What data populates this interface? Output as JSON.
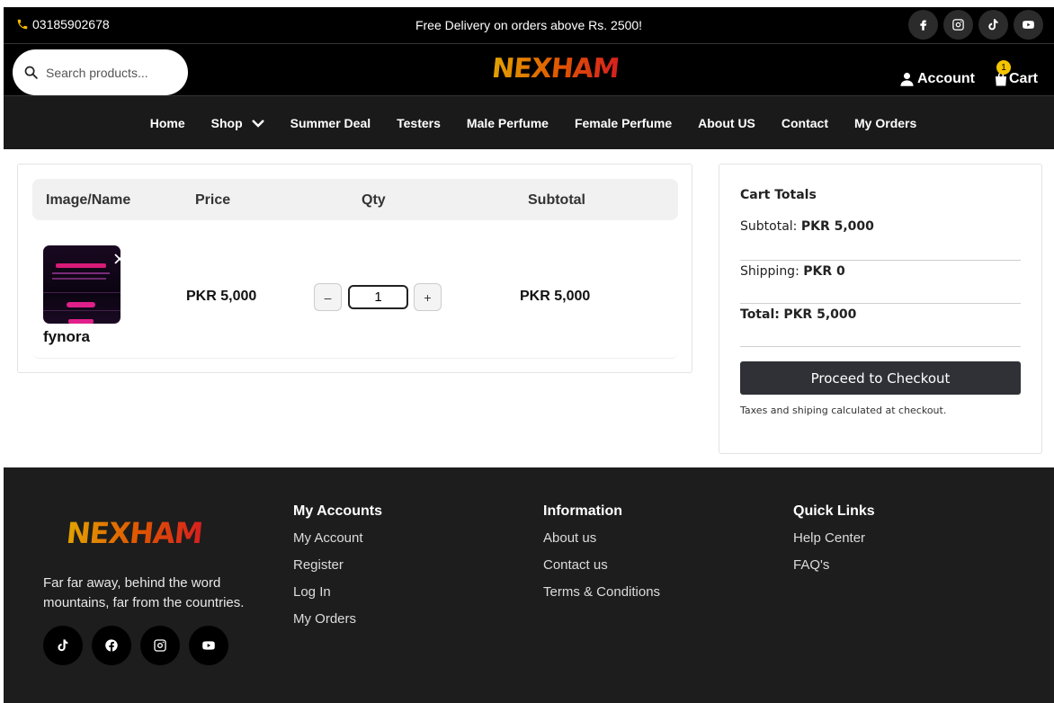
{
  "topbar": {
    "phone": "03185902678",
    "promo": "Free Delivery on orders above Rs. 2500!",
    "social_icons": [
      "facebook-icon",
      "instagram-icon",
      "tiktok-icon",
      "youtube-icon"
    ]
  },
  "header": {
    "search_placeholder": "Search products...",
    "logo": "NEXHAM",
    "account_label": "Account",
    "cart_label": "Cart",
    "cart_count": "1"
  },
  "nav": {
    "items": [
      "Home",
      "Shop",
      "Summer Deal",
      "Testers",
      "Male Perfume",
      "Female Perfume",
      "About US",
      "Contact",
      "My Orders"
    ]
  },
  "cart_table": {
    "headers": [
      "Image/Name",
      "Price",
      "Qty",
      "Subtotal"
    ],
    "rows": [
      {
        "name": "fynora",
        "price": "PKR 5,000",
        "qty": "1",
        "subtotal": "PKR 5,000"
      }
    ],
    "qty_minus": "–",
    "qty_plus": "+"
  },
  "totals": {
    "title": "Cart Totals",
    "subtotal_label": "Subtotal:",
    "subtotal_value": "PKR 5,000",
    "shipping_label": "Shipping:",
    "shipping_value": "PKR 0",
    "total_label": "Total:",
    "total_value": "PKR 5,000",
    "checkout_label": "Proceed to Checkout",
    "note": "Taxes and shiping calculated at checkout."
  },
  "footer": {
    "logo": "NEXHAM",
    "description": "Far far away, behind the word mountains, far from the countries.",
    "social_icons": [
      "tiktok-icon",
      "facebook-icon",
      "instagram-icon",
      "youtube-icon"
    ],
    "columns": [
      {
        "title": "My Accounts",
        "links": [
          "My Account",
          "Register",
          "Log In",
          "My Orders"
        ]
      },
      {
        "title": "Information",
        "links": [
          "About us",
          "Contact us",
          "Terms & Conditions"
        ]
      },
      {
        "title": "Quick Links",
        "links": [
          "Help Center",
          "FAQ's"
        ]
      }
    ]
  },
  "colors": {
    "topbar_bg": "#000000",
    "nav_bg": "#1a1a1a",
    "footer_bg": "#1d1d1d",
    "checkout_bg": "#2f3136",
    "badge": "#f5c400",
    "phone_icon": "#f5b800"
  }
}
